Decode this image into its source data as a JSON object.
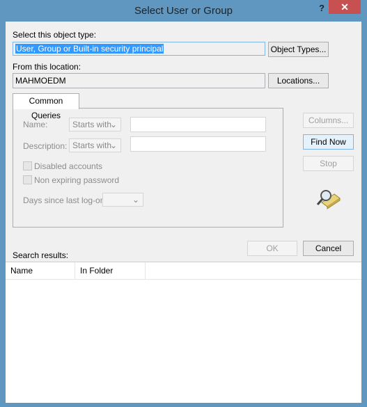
{
  "window": {
    "title": "Select User or Group",
    "help": "?",
    "close": "✕"
  },
  "object_type": {
    "label": "Select this object type:",
    "value": "User, Group or Built-in security principal",
    "button": "Object Types..."
  },
  "location": {
    "label": "From this location:",
    "value": "MAHMOEDM",
    "button": "Locations..."
  },
  "tab": {
    "label": "Common Queries"
  },
  "query": {
    "name_label": "Name:",
    "name_mode": "Starts with",
    "name_value": "",
    "desc_label": "Description:",
    "desc_mode": "Starts with",
    "desc_value": "",
    "disabled_accounts": "Disabled accounts",
    "non_expiring": "Non expiring password",
    "days_label": "Days since last log-on:",
    "days_value": ""
  },
  "buttons": {
    "columns": "Columns...",
    "find_now": "Find Now",
    "stop": "Stop",
    "ok": "OK",
    "cancel": "Cancel"
  },
  "results": {
    "label": "Search results:",
    "columns": [
      "Name",
      "In Folder"
    ]
  }
}
